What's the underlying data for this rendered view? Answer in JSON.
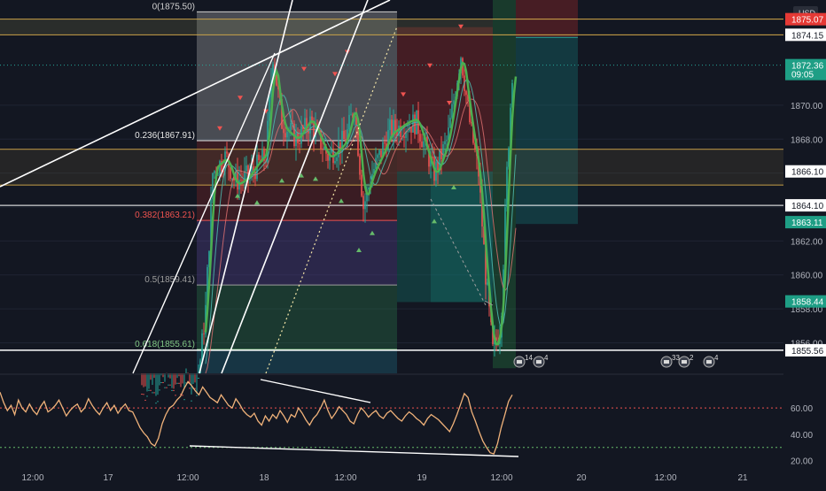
{
  "chart_data": {
    "type": "candlestick",
    "currency_label": "USD",
    "price_axis_ticks": [
      "1870.00",
      "1868.00",
      "1866.00",
      "1864.00",
      "1862.00",
      "1860.00",
      "1858.00",
      "1856.00"
    ],
    "time_axis_ticks": [
      "12:00",
      "17",
      "12:00",
      "18",
      "12:00",
      "19",
      "12:00",
      "20",
      "12:00",
      "21"
    ],
    "price_badges": [
      {
        "text": "1875.07",
        "color": "#e53935",
        "price": 1875.07
      },
      {
        "text": "1874.15",
        "color": "#ffffff",
        "price": 1874.15
      },
      {
        "text": "1872.36",
        "color": "#1e9e85",
        "price": 1872.36,
        "sub": "09:05"
      },
      {
        "text": "1866.10",
        "color": "#ffffff",
        "price": 1866.1
      },
      {
        "text": "1864.10",
        "color": "#ffffff",
        "price": 1864.1
      },
      {
        "text": "1863.11",
        "color": "#1e9e85",
        "price": 1863.11
      },
      {
        "text": "1858.44",
        "color": "#1e9e85",
        "price": 1858.44
      },
      {
        "text": "1855.56",
        "color": "#ffffff",
        "price": 1855.56
      }
    ],
    "fib_levels": [
      {
        "label": "0(1875.50)",
        "price": 1875.5,
        "color": "#d0d0d0"
      },
      {
        "label": "0.236(1867.91)",
        "price": 1867.91,
        "color": "#e8e8e8"
      },
      {
        "label": "0.382(1863.21)",
        "price": 1863.21,
        "color": "#ef5350"
      },
      {
        "label": "0.5(1859.41)",
        "price": 1859.41,
        "color": "#9e9e9e"
      },
      {
        "label": "0.618(1855.61)",
        "price": 1855.61,
        "color": "#81c784"
      }
    ],
    "horizontal_levels": [
      1874.15,
      1867.4,
      1865.3,
      1864.1,
      1855.56
    ],
    "price_range": [
      1854.2,
      1876.2
    ],
    "oscillator": {
      "ticks": [
        "60.00",
        "40.00",
        "20.00"
      ],
      "upper_line": 60,
      "lower_line": 30,
      "range": [
        15,
        85
      ],
      "values": [
        72,
        64,
        58,
        62,
        55,
        66,
        60,
        57,
        63,
        58,
        55,
        61,
        65,
        57,
        59,
        62,
        66,
        60,
        54,
        58,
        61,
        63,
        57,
        60,
        67,
        62,
        58,
        55,
        60,
        64,
        58,
        62,
        56,
        60,
        63,
        58,
        57,
        51,
        45,
        41,
        38,
        33,
        31,
        37,
        48,
        55,
        60,
        62,
        66,
        69,
        75,
        80,
        77,
        73,
        70,
        76,
        72,
        68,
        66,
        64,
        70,
        66,
        62,
        60,
        67,
        63,
        58,
        55,
        53,
        56,
        50,
        47,
        54,
        50,
        55,
        52,
        58,
        54,
        49,
        55,
        53,
        60,
        56,
        51,
        47,
        52,
        55,
        60,
        66,
        58,
        52,
        56,
        61,
        58,
        55,
        50,
        48,
        55,
        60,
        57,
        53,
        56,
        58,
        54,
        52,
        56,
        58,
        55,
        52,
        50,
        54,
        57,
        55,
        52,
        50,
        47,
        52,
        55,
        53,
        51,
        48,
        45,
        42,
        48,
        55,
        63,
        71,
        68,
        57,
        50,
        42,
        35,
        30,
        26,
        25,
        33,
        45,
        55,
        65,
        70
      ]
    }
  }
}
